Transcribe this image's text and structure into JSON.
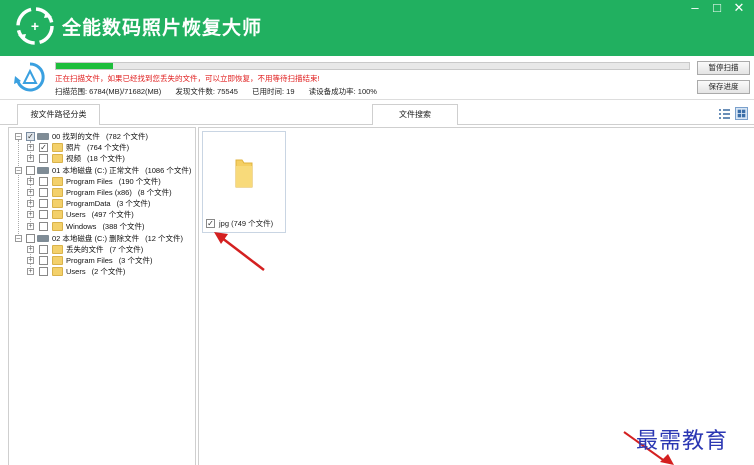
{
  "window": {
    "title": "全能数码照片恢复大师",
    "controls": {
      "minimize": "–",
      "maximize": "□",
      "close": "✕"
    }
  },
  "scan": {
    "progress": 0.09,
    "warning": "正在扫描文件，如果已经找到您丢失的文件，可以立即恢复，不用等待扫描结束!",
    "range_label": "扫描范围: 6784(MB)/71682(MB)",
    "found_label": "发现文件数: 75545",
    "time_label": "已用时间: 19",
    "success_label": "读设备成功率: 100%",
    "pause_button": "暂停扫描",
    "save_button": "保存进度"
  },
  "tabs": {
    "by_path": "按文件路径分类",
    "search": "文件搜索"
  },
  "tree": {
    "root0": {
      "label": "00 找到的文件",
      "count": "(782 个文件)"
    },
    "photos": {
      "label": "照片",
      "count": "(764 个文件)"
    },
    "videos": {
      "label": "视频",
      "count": "(18 个文件)"
    },
    "root1": {
      "label": "01 本地磁盘 (C:) 正常文件",
      "count": "(1086 个文件)"
    },
    "program_files": {
      "label": "Program Files",
      "count": "(190 个文件)"
    },
    "program_files_x86": {
      "label": "Program Files (x86)",
      "count": "(8 个文件)"
    },
    "program_data": {
      "label": "ProgramData",
      "count": "(3 个文件)"
    },
    "users": {
      "label": "Users",
      "count": "(497 个文件)"
    },
    "windows": {
      "label": "Windows",
      "count": "(388 个文件)"
    },
    "root2": {
      "label": "02 本地磁盘 (C:) 删除文件",
      "count": "(12 个文件)"
    },
    "lost_files": {
      "label": "丢失的文件",
      "count": "(7 个文件)"
    },
    "program_files_del": {
      "label": "Program Files",
      "count": "(3 个文件)"
    },
    "users_del": {
      "label": "Users",
      "count": "(2 个文件)"
    }
  },
  "files": {
    "card_label": "jpg (749 个文件)"
  },
  "colors": {
    "titlebar": "#21b060",
    "progress": "#1ebe3c",
    "warning": "#e02020",
    "annotation_arrow": "#d42020",
    "watermark": "#2b37b3"
  },
  "icons": [
    "app-logo-icon",
    "scan-status-icon",
    "list-view-icon",
    "grid-view-icon",
    "folder-icon",
    "drive-icon"
  ],
  "watermark": "最需教育"
}
